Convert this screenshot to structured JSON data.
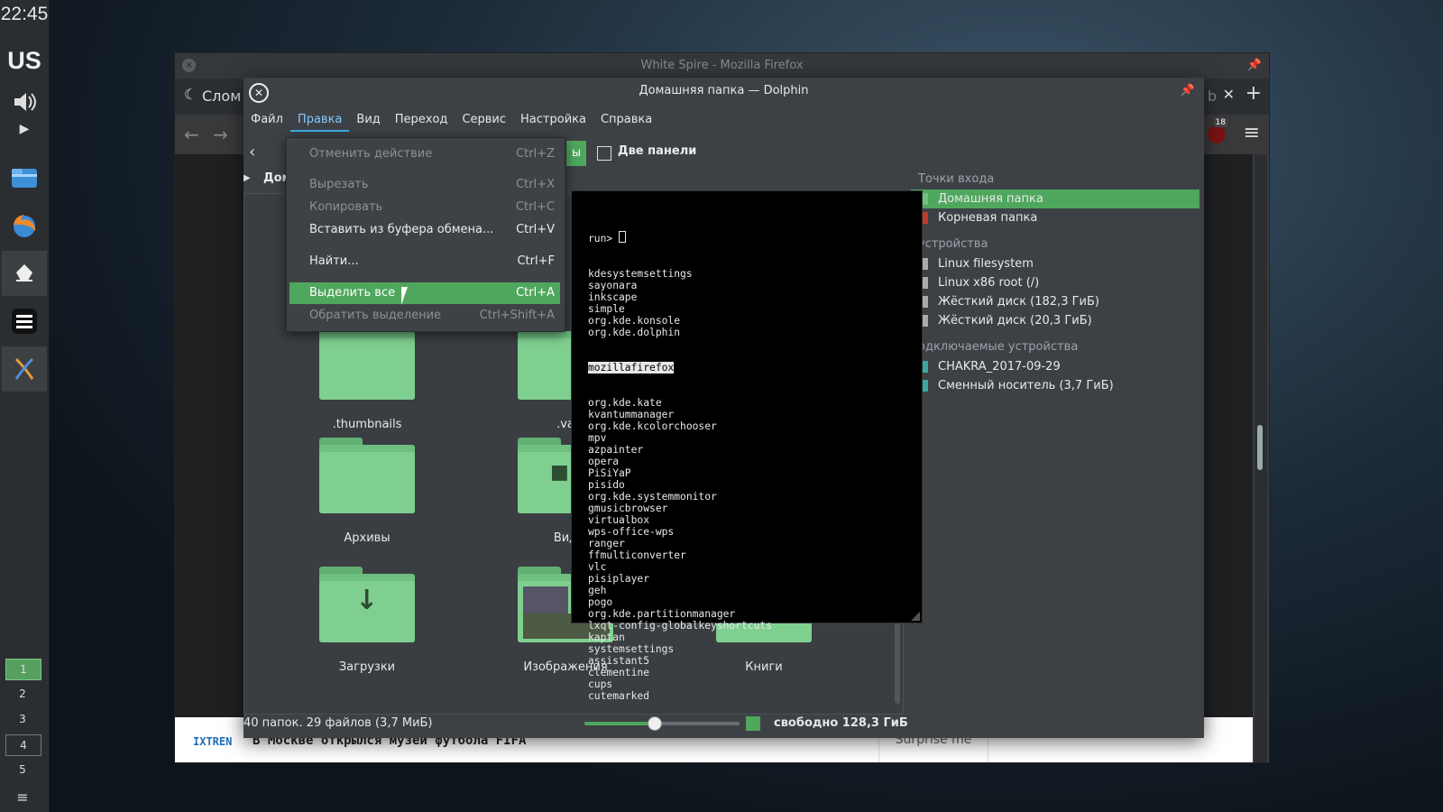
{
  "panel": {
    "clock": "22:45",
    "lang": "US",
    "desktops": [
      "1",
      "2",
      "3",
      "4",
      "5"
    ]
  },
  "firefox": {
    "title": "White Spire - Mozilla Firefox",
    "tab_label": "Слом",
    "tab_extra": "b",
    "badge": "18",
    "news_source": "IXTREN",
    "news_text": "В Москве открылся музей футбола FIFA",
    "news_button": "Surprise me"
  },
  "dolphin": {
    "title": "Домашняя папка — Dolphin",
    "menu": [
      "Файл",
      "Правка",
      "Вид",
      "Переход",
      "Сервис",
      "Настройка",
      "Справка"
    ],
    "toolbar_partial": "ы",
    "split_label": "Две панели",
    "breadcrumb_partial": "Дом",
    "folders": [
      {
        "label": ".thumbnails"
      },
      {
        "label": ".va"
      },
      {
        "label": "Архивы"
      },
      {
        "label": "Вид"
      },
      {
        "label": "Загрузки"
      },
      {
        "label": "Изображения"
      },
      {
        "label": "Книги"
      }
    ],
    "places": {
      "header1": "Точки входа",
      "home": "Домашняя папка",
      "root": "Корневая папка",
      "header2": "устройства",
      "dev1": "Linux filesystem",
      "dev2": "Linux x86 root (/)",
      "dev3": "Жёсткий диск (182,3 ГиБ)",
      "dev4": "Жёсткий диск (20,3 ГиБ)",
      "header3": "одключаемые устройства",
      "rem1": "CHAKRA_2017-09-29",
      "rem2": "Сменный носитель (3,7 ГиБ)"
    },
    "status": "40 папок. 29 файлов (3,7 МиБ)",
    "free": "свободно 128,3 ГиБ"
  },
  "edit_menu": [
    {
      "label": "Отменить действие",
      "shortcut": "Ctrl+Z"
    },
    {
      "label": "Вырезать",
      "shortcut": "Ctrl+X"
    },
    {
      "label": "Копировать",
      "shortcut": "Ctrl+C"
    },
    {
      "label": "Вставить из буфера обмена...",
      "shortcut": "Ctrl+V"
    },
    {
      "label": "Найти...",
      "shortcut": "Ctrl+F"
    },
    {
      "label": "Выделить все",
      "shortcut": "Ctrl+A"
    },
    {
      "label": "Обратить выделение",
      "shortcut": "Ctrl+Shift+A"
    }
  ],
  "run": {
    "prompt": "run>",
    "items_before": [
      "kdesystemsettings",
      "sayonara",
      "inkscape",
      "simple",
      "org.kde.konsole",
      "org.kde.dolphin"
    ],
    "selected": "mozillafirefox",
    "items_after": [
      "org.kde.kate",
      "kvantummanager",
      "org.kde.kcolorchooser",
      "mpv",
      "azpainter",
      "opera",
      "PiSiYaP",
      "pisido",
      "org.kde.systemmonitor",
      "gmusicbrowser",
      "virtualbox",
      "wps-office-wps",
      "ranger",
      "ffmulticonverter",
      "vlc",
      "pisiplayer",
      "geh",
      "pogo",
      "org.kde.partitionmanager",
      "lxqt-config-globalkeyshortcuts",
      "kaptan",
      "systemsettings",
      "assistant5",
      "clementine",
      "cups",
      "cutemarked"
    ]
  },
  "colors": {
    "accent_green": "#4fa75d",
    "menu_active": "#3daee9",
    "folder_green": "#7fcf90"
  }
}
